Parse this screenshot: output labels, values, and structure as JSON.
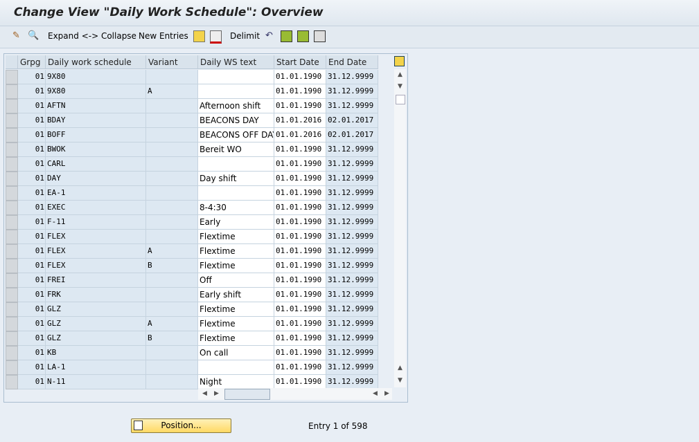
{
  "title": "Change View \"Daily Work Schedule\": Overview",
  "toolbar": {
    "expand_collapse": "Expand <-> Collapse",
    "new_entries": "New Entries",
    "delimit": "Delimit"
  },
  "table": {
    "columns": [
      "Grpg",
      "Daily work schedule",
      "Variant",
      "Daily WS text",
      "Start Date",
      "End Date"
    ],
    "rows": [
      [
        "01",
        "9X80",
        "",
        "",
        "01.01.1990",
        "31.12.9999"
      ],
      [
        "01",
        "9X80",
        "A",
        "",
        "01.01.1990",
        "31.12.9999"
      ],
      [
        "01",
        "AFTN",
        "",
        "Afternoon shift",
        "01.01.1990",
        "31.12.9999"
      ],
      [
        "01",
        "BDAY",
        "",
        "BEACONS DAY",
        "01.01.2016",
        "02.01.2017"
      ],
      [
        "01",
        "BOFF",
        "",
        "BEACONS OFF DAY",
        "01.01.2016",
        "02.01.2017"
      ],
      [
        "01",
        "BWOK",
        "",
        "Bereit WO",
        "01.01.1990",
        "31.12.9999"
      ],
      [
        "01",
        "CARL",
        "",
        "",
        "01.01.1990",
        "31.12.9999"
      ],
      [
        "01",
        "DAY",
        "",
        "Day shift",
        "01.01.1990",
        "31.12.9999"
      ],
      [
        "01",
        "EA-1",
        "",
        "",
        "01.01.1990",
        "31.12.9999"
      ],
      [
        "01",
        "EXEC",
        "",
        "8-4:30",
        "01.01.1990",
        "31.12.9999"
      ],
      [
        "01",
        "F-11",
        "",
        "Early",
        "01.01.1990",
        "31.12.9999"
      ],
      [
        "01",
        "FLEX",
        "",
        "Flextime",
        "01.01.1990",
        "31.12.9999"
      ],
      [
        "01",
        "FLEX",
        "A",
        "Flextime",
        "01.01.1990",
        "31.12.9999"
      ],
      [
        "01",
        "FLEX",
        "B",
        "Flextime",
        "01.01.1990",
        "31.12.9999"
      ],
      [
        "01",
        "FREI",
        "",
        "Off",
        "01.01.1990",
        "31.12.9999"
      ],
      [
        "01",
        "FRK",
        "",
        "Early shift",
        "01.01.1990",
        "31.12.9999"
      ],
      [
        "01",
        "GLZ",
        "",
        "Flextime",
        "01.01.1990",
        "31.12.9999"
      ],
      [
        "01",
        "GLZ",
        "A",
        "Flextime",
        "01.01.1990",
        "31.12.9999"
      ],
      [
        "01",
        "GLZ",
        "B",
        "Flextime",
        "01.01.1990",
        "31.12.9999"
      ],
      [
        "01",
        "KB",
        "",
        "On call",
        "01.01.1990",
        "31.12.9999"
      ],
      [
        "01",
        "LA-1",
        "",
        "",
        "01.01.1990",
        "31.12.9999"
      ],
      [
        "01",
        "N-11",
        "",
        "Night",
        "01.01.1990",
        "31.12.9999"
      ]
    ]
  },
  "footer": {
    "position_label": "Position...",
    "entry_text": "Entry 1 of 598"
  }
}
